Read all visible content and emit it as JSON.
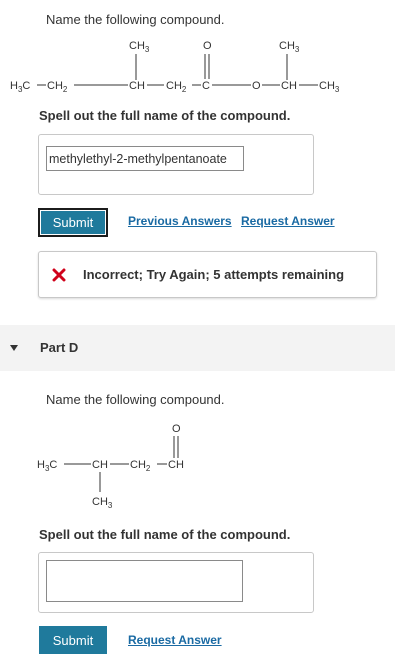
{
  "part_c": {
    "prompt": "Name the following compound.",
    "question": "Spell out the full name of the compound.",
    "answer_value": "methylethyl-2-methylpentanoate",
    "submit_label": "Submit",
    "previous_answers_label": "Previous Answers",
    "request_answer_label": "Request Answer",
    "feedback_text": "Incorrect; Try Again; 5 attempts remaining",
    "structure": {
      "ch3_left_top": "CH3",
      "o_double": "O",
      "ch3_right_top": "CH3",
      "h3c": "H3C",
      "ch2_a": "CH2",
      "ch_a": "CH",
      "ch2_b": "CH2",
      "c_carbonyl": "C",
      "o_ester": "O",
      "ch_b": "CH",
      "ch3_end": "CH3"
    }
  },
  "part_d": {
    "header": "Part D",
    "prompt": "Name the following compound.",
    "question": "Spell out the full name of the compound.",
    "answer_value": "",
    "submit_label": "Submit",
    "request_answer_label": "Request Answer",
    "structure": {
      "o_double": "O",
      "h3c": "H3C",
      "ch": "CH",
      "ch2": "CH2",
      "ch_aldehyde": "CH",
      "ch3_bottom": "CH3"
    }
  },
  "colors": {
    "button": "#1f7a9c",
    "link": "#1a6aa3",
    "error_x": "#d0021b",
    "part_header_bg": "#f3f3f3"
  }
}
